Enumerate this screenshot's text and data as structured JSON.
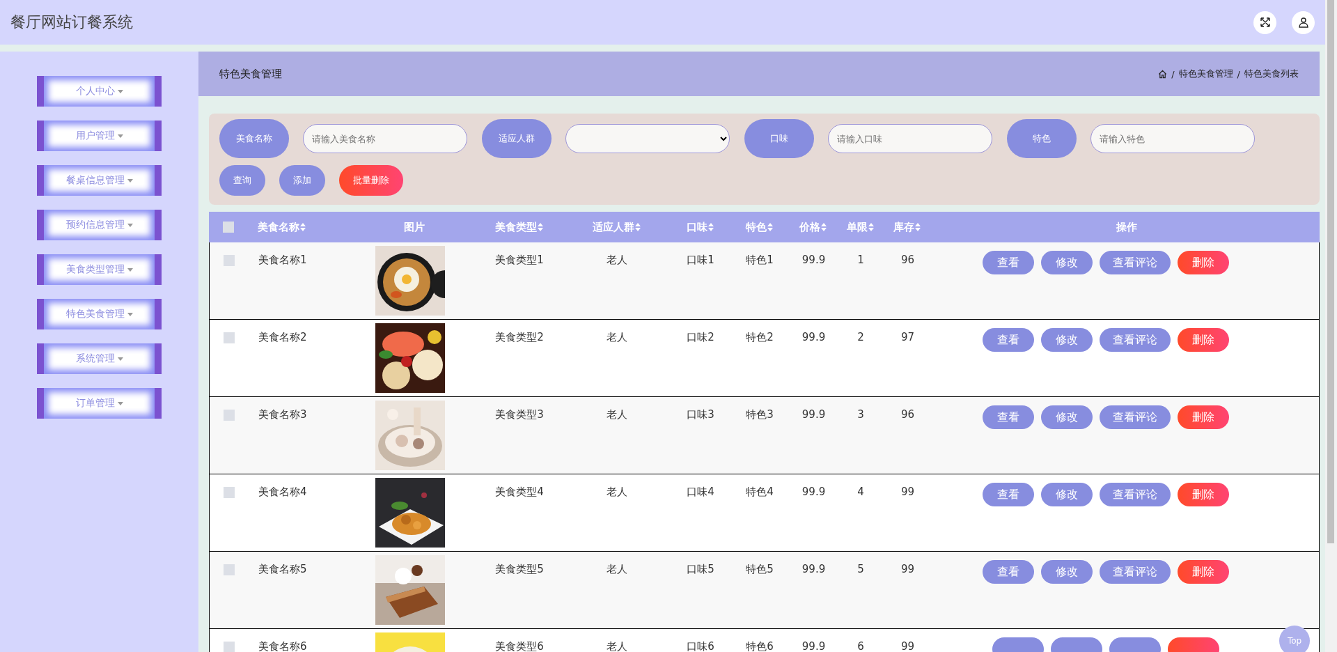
{
  "header": {
    "title": "餐厅网站订餐系统"
  },
  "sidebar": {
    "items": [
      {
        "label": "个人中心"
      },
      {
        "label": "用户管理"
      },
      {
        "label": "餐桌信息管理"
      },
      {
        "label": "预约信息管理"
      },
      {
        "label": "美食类型管理"
      },
      {
        "label": "特色美食管理"
      },
      {
        "label": "系统管理"
      },
      {
        "label": "订单管理"
      }
    ]
  },
  "page_bar": {
    "title": "特色美食管理",
    "breadcrumb": [
      {
        "separator": "/",
        "label": "特色美食管理"
      },
      {
        "separator": "/",
        "label": "特色美食列表"
      }
    ]
  },
  "search": {
    "fields": [
      {
        "label": "美食名称",
        "kind": "input",
        "placeholder": "请输入美食名称"
      },
      {
        "label": "适应人群",
        "kind": "select"
      },
      {
        "label": "口味",
        "kind": "input",
        "placeholder": "请输入口味"
      },
      {
        "label": "特色",
        "kind": "input",
        "placeholder": "请输入特色"
      }
    ],
    "buttons": [
      {
        "label": "查询",
        "kind": "normal"
      },
      {
        "label": "添加",
        "kind": "normal"
      },
      {
        "label": "批量删除",
        "kind": "danger"
      }
    ]
  },
  "table": {
    "select_all": {
      "checked": false
    },
    "columns": [
      {
        "label": "美食名称",
        "sortable": true
      },
      {
        "label": "图片",
        "sortable": false
      },
      {
        "label": "美食类型",
        "sortable": true
      },
      {
        "label": "适应人群",
        "sortable": true
      },
      {
        "label": "口味",
        "sortable": true
      },
      {
        "label": "特色",
        "sortable": true
      },
      {
        "label": "价格",
        "sortable": true
      },
      {
        "label": "单限",
        "sortable": true
      },
      {
        "label": "库存",
        "sortable": true
      },
      {
        "label": "操作",
        "sortable": false
      }
    ],
    "rows": [
      {
        "checked": false,
        "name": "美食名称1",
        "type": "美食类型1",
        "crowd": "老人",
        "taste": "口味1",
        "feature": "特色1",
        "price": "99.9",
        "limit": "1",
        "stock": "96",
        "actions": [
          {
            "label": "查看",
            "kind": "normal"
          },
          {
            "label": "修改",
            "kind": "normal"
          },
          {
            "label": "查看评论",
            "kind": "normal"
          },
          {
            "label": "删除",
            "kind": "danger"
          }
        ]
      },
      {
        "checked": false,
        "name": "美食名称2",
        "type": "美食类型2",
        "crowd": "老人",
        "taste": "口味2",
        "feature": "特色2",
        "price": "99.9",
        "limit": "2",
        "stock": "97",
        "actions": [
          {
            "label": "查看",
            "kind": "normal"
          },
          {
            "label": "修改",
            "kind": "normal"
          },
          {
            "label": "查看评论",
            "kind": "normal"
          },
          {
            "label": "删除",
            "kind": "danger"
          }
        ]
      },
      {
        "checked": false,
        "name": "美食名称3",
        "type": "美食类型3",
        "crowd": "老人",
        "taste": "口味3",
        "feature": "特色3",
        "price": "99.9",
        "limit": "3",
        "stock": "96",
        "actions": [
          {
            "label": "查看",
            "kind": "normal"
          },
          {
            "label": "修改",
            "kind": "normal"
          },
          {
            "label": "查看评论",
            "kind": "normal"
          },
          {
            "label": "删除",
            "kind": "danger"
          }
        ]
      },
      {
        "checked": false,
        "name": "美食名称4",
        "type": "美食类型4",
        "crowd": "老人",
        "taste": "口味4",
        "feature": "特色4",
        "price": "99.9",
        "limit": "4",
        "stock": "99",
        "actions": [
          {
            "label": "查看",
            "kind": "normal"
          },
          {
            "label": "修改",
            "kind": "normal"
          },
          {
            "label": "查看评论",
            "kind": "normal"
          },
          {
            "label": "删除",
            "kind": "danger"
          }
        ]
      },
      {
        "checked": false,
        "name": "美食名称5",
        "type": "美食类型5",
        "crowd": "老人",
        "taste": "口味5",
        "feature": "特色5",
        "price": "99.9",
        "limit": "5",
        "stock": "99",
        "actions": [
          {
            "label": "查看",
            "kind": "normal"
          },
          {
            "label": "修改",
            "kind": "normal"
          },
          {
            "label": "查看评论",
            "kind": "normal"
          },
          {
            "label": "删除",
            "kind": "danger"
          }
        ]
      },
      {
        "checked": false,
        "name": "美食名称6",
        "type": "美食类型6",
        "crowd": "老人",
        "taste": "口味6",
        "feature": "特色6",
        "price": "99.9",
        "limit": "6",
        "stock": "99",
        "actions": [
          {
            "kind": "normal"
          },
          {
            "kind": "normal"
          },
          {
            "kind": "normal"
          },
          {
            "kind": "danger"
          }
        ]
      }
    ]
  },
  "back_to_top": {
    "label": "Top"
  }
}
